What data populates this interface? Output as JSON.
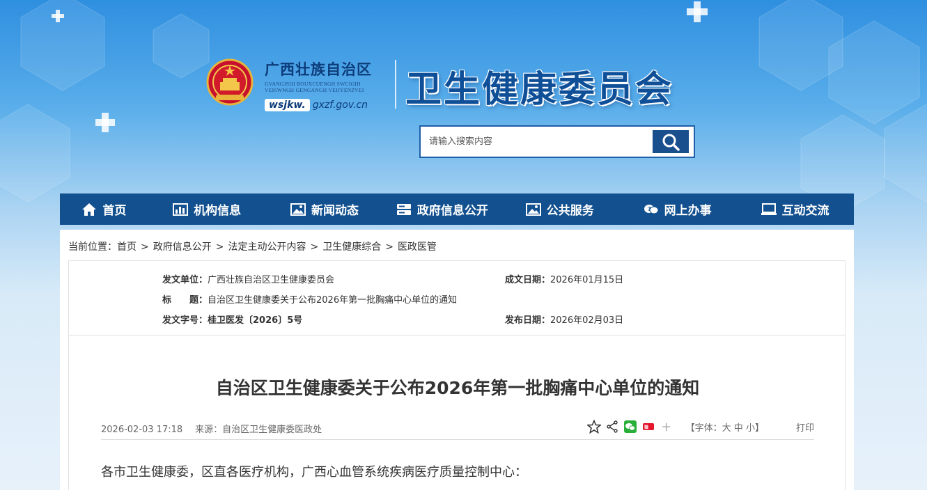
{
  "header": {
    "org_name": "广西壮族自治区",
    "org_latin_1": "GVANGJSIH BOUXCUENGH SWCIGIH",
    "org_latin_2": "VEISWNGH GENGANGH VEIJYENZVEI",
    "url_prefix": "wsjkw.",
    "url_rest": "gxzf.gov.cn",
    "title": "卫生健康委员会"
  },
  "search": {
    "placeholder": "请输入搜索内容"
  },
  "nav": [
    {
      "label": "首页",
      "icon": "home-icon"
    },
    {
      "label": "机构信息",
      "icon": "bar-chart-icon"
    },
    {
      "label": "新闻动态",
      "icon": "image-icon"
    },
    {
      "label": "政府信息公开",
      "icon": "server-icon"
    },
    {
      "label": "公共服务",
      "icon": "image-icon"
    },
    {
      "label": "网上办事",
      "icon": "chat-icon"
    },
    {
      "label": "互动交流",
      "icon": "monitor-icon"
    }
  ],
  "breadcrumb": {
    "prefix": "当前位置：",
    "items": [
      "首页",
      "政府信息公开",
      "法定主动公开内容",
      "卫生健康综合",
      "医政医管"
    ],
    "separator": ">"
  },
  "meta": {
    "issuer_label": "发文单位：",
    "issuer": "广西壮族自治区卫生健康委员会",
    "date_label": "成文日期：",
    "date": "2026年01月15日",
    "title_label": "标　　题：",
    "title": "自治区卫生健康委关于公布2026年第一批胸痛中心单位的通知",
    "docno_label": "发文字号：",
    "docno": "桂卫医发〔2026〕5号",
    "publish_label": "发布日期：",
    "publish_date": "2026年02月03日"
  },
  "article": {
    "title": "自治区卫生健康委关于公布2026年第一批胸痛中心单位的通知",
    "datetime": "2026-02-03 17:18",
    "source": "来源：自治区卫生健康委医政处",
    "font_label_open": "【字体：",
    "font_large": "大",
    "font_medium": "中",
    "font_small": "小",
    "font_label_close": "】",
    "print": "打印",
    "plus": "+",
    "body_first_line": "各市卫生健康委，区直各医疗机构，广西心血管系统疾病医疗质量控制中心："
  },
  "colors": {
    "nav_bg": "#12508f",
    "title_blue": "#0f4f98"
  }
}
